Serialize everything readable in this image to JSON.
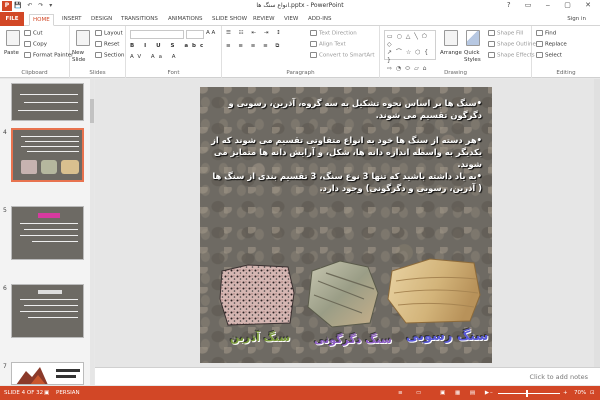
{
  "window": {
    "title": "انواع سنگ ها.pptx - PowerPoint",
    "sign_in": "Sign in"
  },
  "tabs": [
    "FILE",
    "HOME",
    "INSERT",
    "DESIGN",
    "TRANSITIONS",
    "ANIMATIONS",
    "SLIDE SHOW",
    "REVIEW",
    "VIEW",
    "ADD-INS"
  ],
  "ribbon": {
    "clipboard": {
      "label": "Clipboard",
      "paste": "Paste",
      "cut": "Cut",
      "copy": "Copy",
      "format_painter": "Format Painter"
    },
    "slides": {
      "label": "Slides",
      "new_slide": "New Slide",
      "layout": "Layout",
      "reset": "Reset",
      "section": "Section"
    },
    "font": {
      "label": "Font"
    },
    "paragraph": {
      "label": "Paragraph",
      "text_direction": "Text Direction",
      "align_text": "Align Text",
      "convert_smartart": "Convert to SmartArt"
    },
    "drawing": {
      "label": "Drawing",
      "arrange": "Arrange",
      "quick_styles": "Quick Styles",
      "shape_fill": "Shape Fill",
      "shape_outline": "Shape Outline",
      "shape_effects": "Shape Effects"
    },
    "editing": {
      "label": "Editing",
      "find": "Find",
      "replace": "Replace",
      "select": "Select"
    }
  },
  "thumbnails": {
    "numbers": [
      "4",
      "5",
      "6",
      "7"
    ]
  },
  "slide": {
    "para1": "•سنگ ها بر اساس نحوه تشکیل به سه گروه، آذرین، رسوبی و دگرگون تقسیم می شوند.",
    "para2": "•هر دسته از سنگ ها خود به انواع متفاوتی تقسیم می شوند که از یکدیگر به واسطه اندازه دانه ها، شکل، و آرایش دانه ها متمایز می شوند.",
    "para3": "•به یاد داشته باشید که تنها 3 نوع سنگ، 3 تقسیم بندی از سنگ ها ( آذرین، رسوبی و دگرگونی) وجود دارد.",
    "labels": {
      "igneous": "سنگ آذرین",
      "metamorphic": "سنگ دگرگونی",
      "sedimentary": "سنگ رسوبی"
    }
  },
  "notes_placeholder": "Click to add notes",
  "status": {
    "slide": "SLIDE 4 OF 32",
    "language": "PERSIAN",
    "zoom": "70%"
  },
  "colors": {
    "accent": "#d24726"
  }
}
